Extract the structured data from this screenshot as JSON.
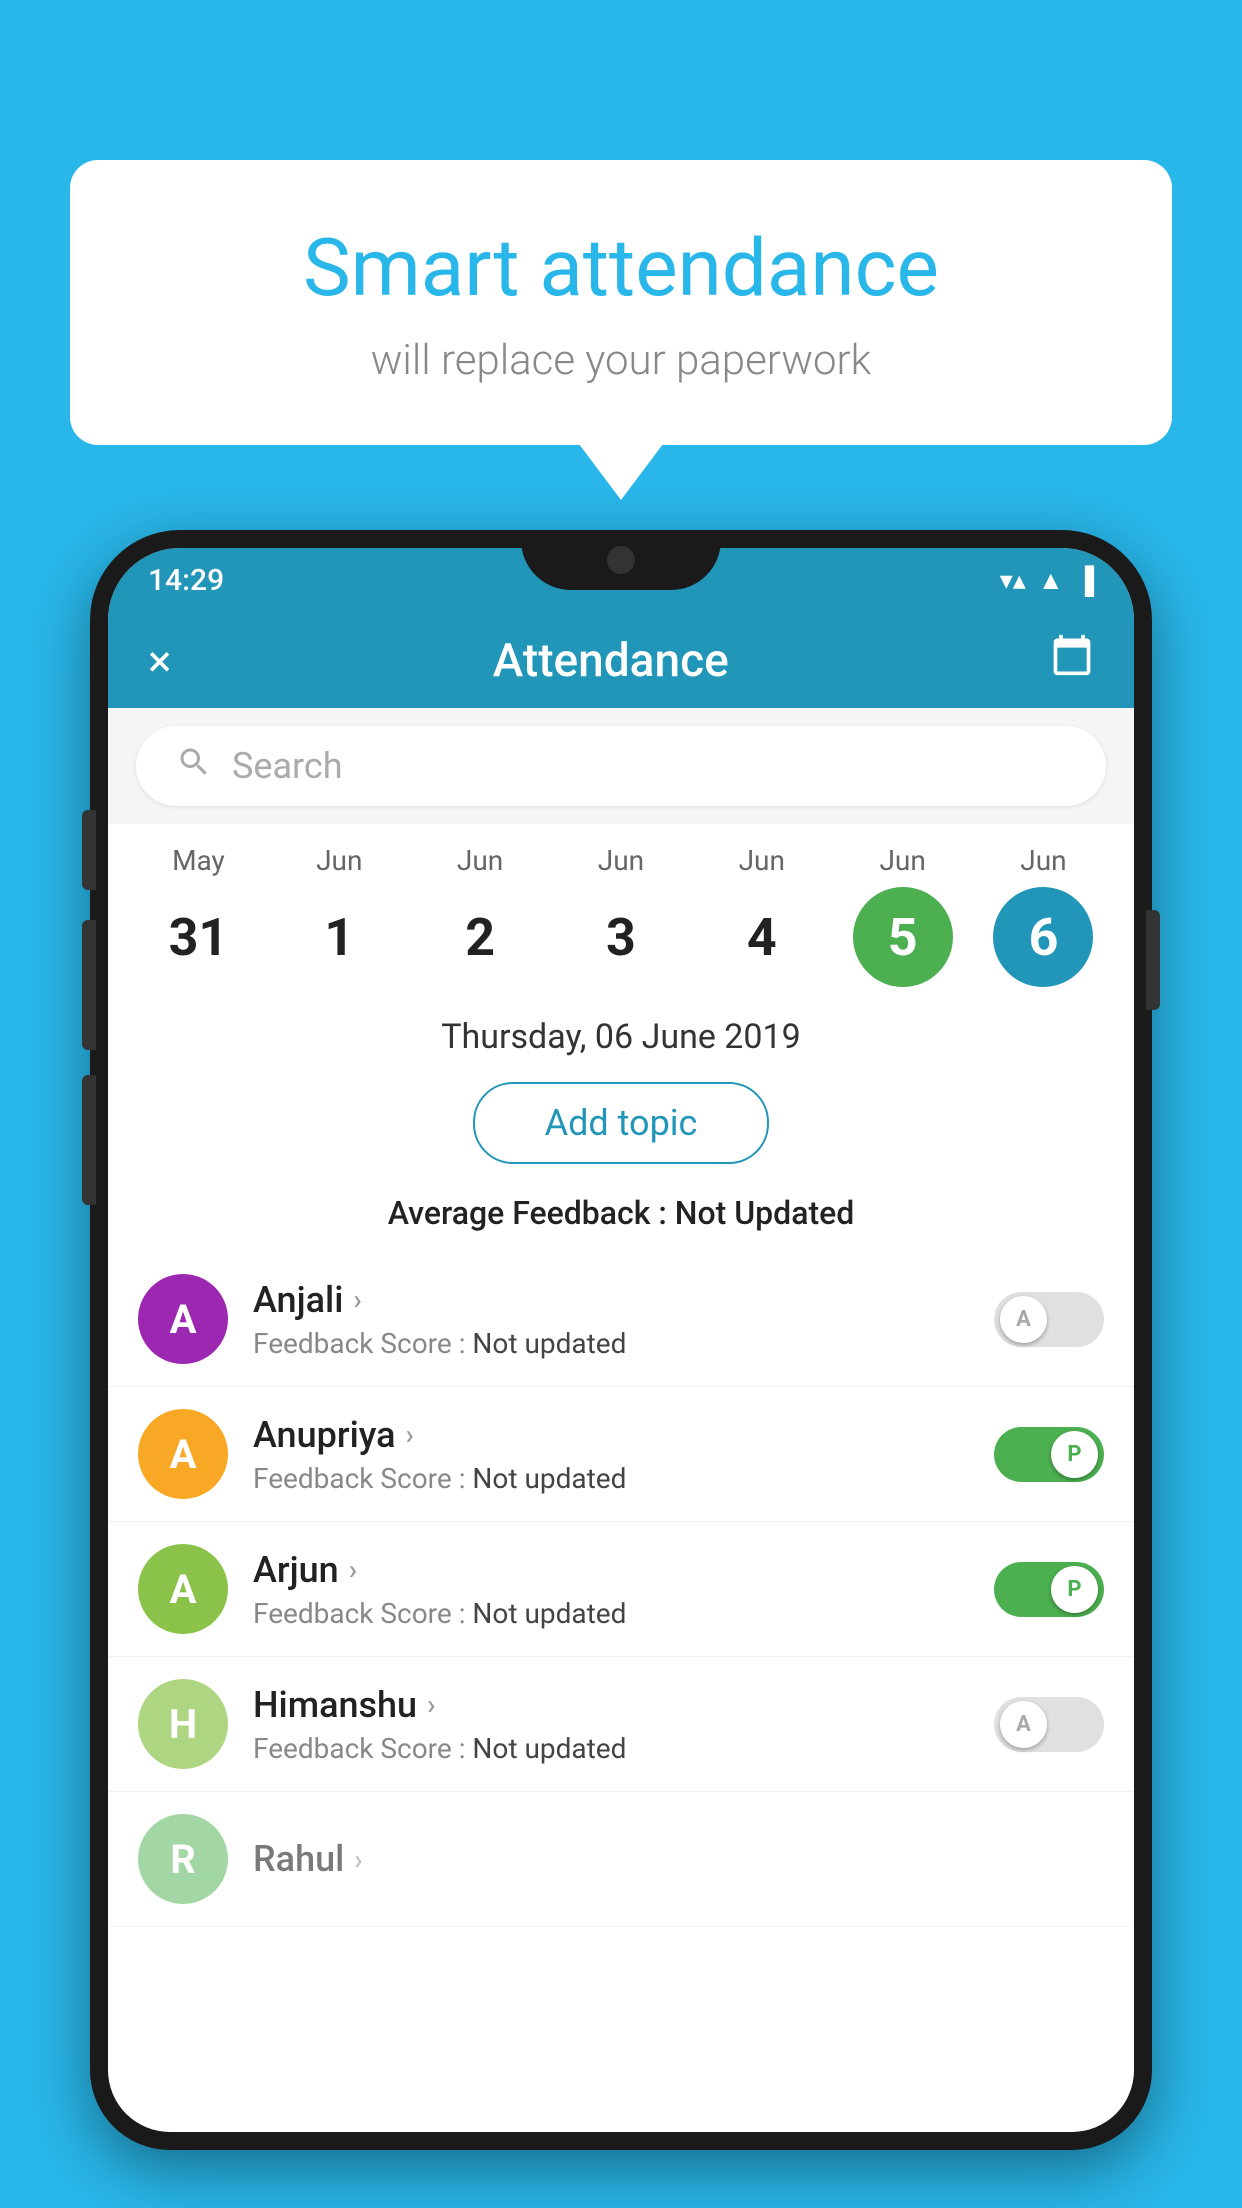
{
  "background_color": "#29b6e8",
  "bubble": {
    "title": "Smart attendance",
    "subtitle": "will replace your paperwork"
  },
  "status_bar": {
    "time": "14:29",
    "wifi": "▼",
    "signal": "▲",
    "battery": "▌"
  },
  "toolbar": {
    "title": "Attendance",
    "close_label": "×",
    "calendar_icon": "calendar"
  },
  "search": {
    "placeholder": "Search"
  },
  "calendar": {
    "days": [
      {
        "month": "May",
        "number": "31",
        "state": "normal"
      },
      {
        "month": "Jun",
        "number": "1",
        "state": "normal"
      },
      {
        "month": "Jun",
        "number": "2",
        "state": "normal"
      },
      {
        "month": "Jun",
        "number": "3",
        "state": "normal"
      },
      {
        "month": "Jun",
        "number": "4",
        "state": "normal"
      },
      {
        "month": "Jun",
        "number": "5",
        "state": "today"
      },
      {
        "month": "Jun",
        "number": "6",
        "state": "selected"
      }
    ]
  },
  "selected_date": "Thursday, 06 June 2019",
  "add_topic_label": "Add topic",
  "avg_feedback_label": "Average Feedback :",
  "avg_feedback_value": "Not Updated",
  "students": [
    {
      "name": "Anjali",
      "avatar_letter": "A",
      "avatar_color": "#9c27b0",
      "feedback": "Feedback Score : Not updated",
      "attendance": "absent",
      "toggle_letter": "A"
    },
    {
      "name": "Anupriya",
      "avatar_letter": "A",
      "avatar_color": "#f9a825",
      "feedback": "Feedback Score : Not updated",
      "attendance": "present",
      "toggle_letter": "P"
    },
    {
      "name": "Arjun",
      "avatar_letter": "A",
      "avatar_color": "#8bc34a",
      "feedback": "Feedback Score : Not updated",
      "attendance": "present",
      "toggle_letter": "P"
    },
    {
      "name": "Himanshu",
      "avatar_letter": "H",
      "avatar_color": "#aed581",
      "feedback": "Feedback Score : Not updated",
      "attendance": "absent",
      "toggle_letter": "A"
    }
  ]
}
